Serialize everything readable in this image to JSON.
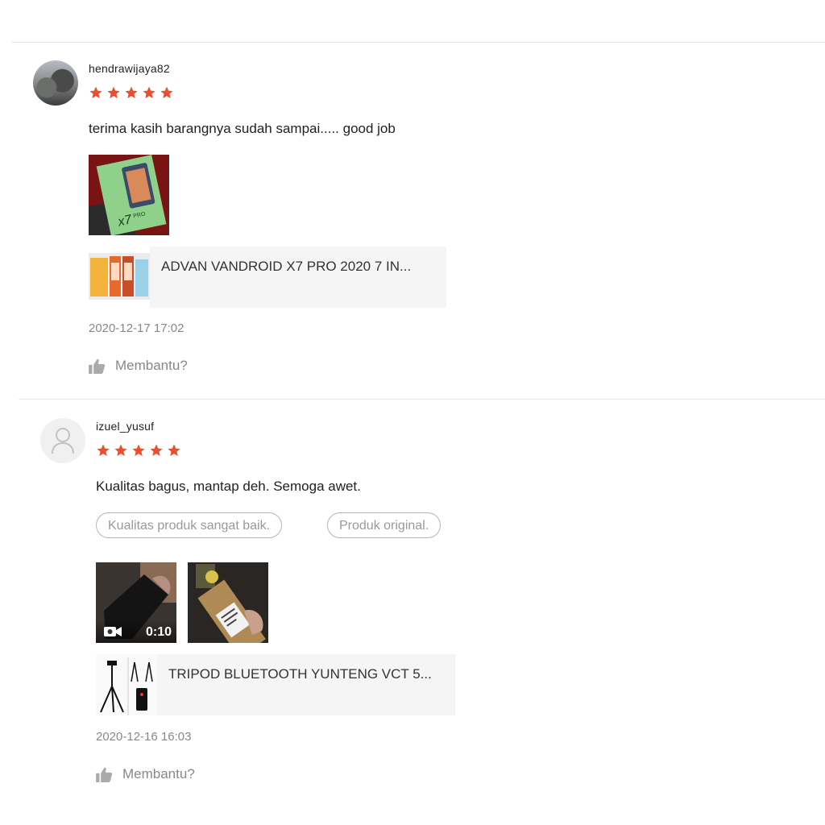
{
  "accent_color": "#ee4d2d",
  "reviews": [
    {
      "username": "hendrawijaya82",
      "rating": 5,
      "comment": "terima kasih barangnya sudah sampai..... good job",
      "tags": [],
      "media": [
        {
          "type": "image",
          "label": "x7 PRO"
        }
      ],
      "product_name": "ADVAN VANDROID X7 PRO 2020 7 IN...",
      "timestamp": "2020-12-17 17:02",
      "helpful_label": "Membantu?"
    },
    {
      "username": "izuel_yusuf",
      "rating": 5,
      "comment": "Kualitas bagus, mantap deh. Semoga awet.",
      "tags": [
        "Kualitas produk sangat baik.",
        "Produk original."
      ],
      "media": [
        {
          "type": "video",
          "duration": "0:10"
        },
        {
          "type": "image"
        }
      ],
      "product_name": "TRIPOD BLUETOOTH YUNTENG VCT 5...",
      "timestamp": "2020-12-16 16:03",
      "helpful_label": "Membantu?"
    }
  ]
}
